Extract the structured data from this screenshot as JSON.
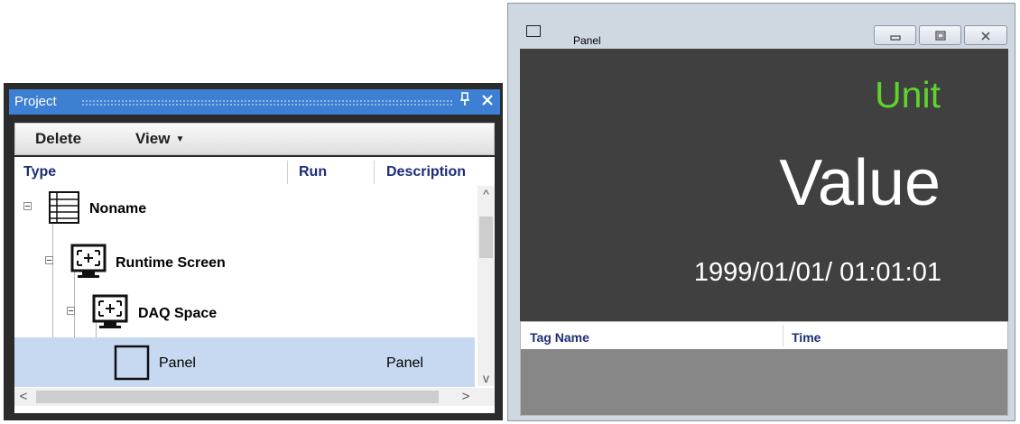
{
  "project": {
    "title": "Project",
    "toolbar": {
      "delete_label": "Delete",
      "view_label": "View"
    },
    "columns": {
      "type": "Type",
      "run": "Run",
      "description": "Description"
    },
    "tree": [
      {
        "label": "Noname",
        "icon": "list-document-icon",
        "description": ""
      },
      {
        "label": "Runtime Screen",
        "icon": "monitor-focus-icon",
        "description": ""
      },
      {
        "label": "DAQ Space",
        "icon": "monitor-focus-icon",
        "description": ""
      },
      {
        "label": "Panel",
        "icon": "panel-square-icon",
        "description": "Panel",
        "selected": true
      }
    ]
  },
  "panel_window": {
    "title": "Panel",
    "unit": "Unit",
    "value": "Value",
    "timestamp": "1999/01/01/ 01:01:01",
    "columns": {
      "tag_name": "Tag Name",
      "time": "Time"
    },
    "colors": {
      "unit": "#5fd32c",
      "value": "#ffffff",
      "background": "#404040"
    }
  }
}
